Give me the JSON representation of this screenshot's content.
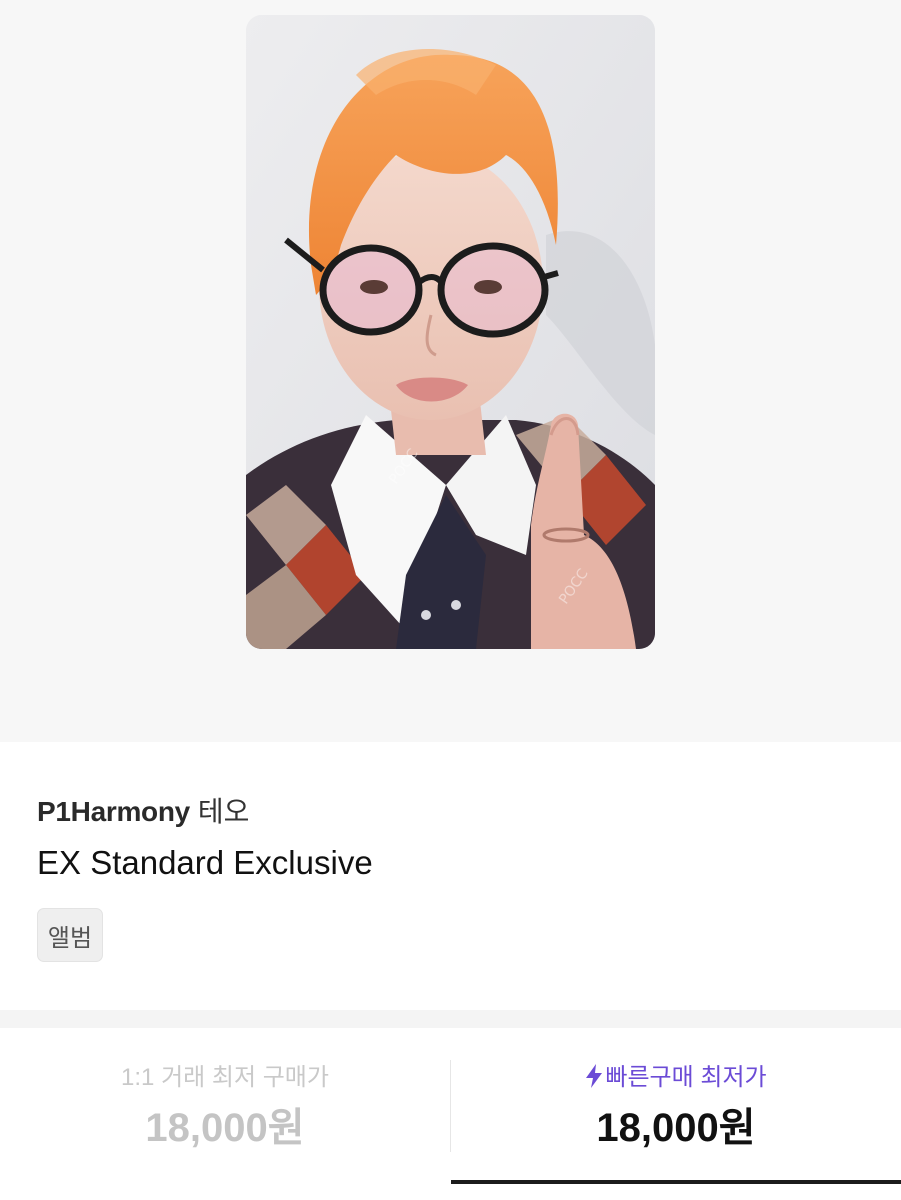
{
  "product": {
    "artist": "P1Harmony",
    "member": "테오",
    "title": "EX Standard Exclusive",
    "tag": "앨범"
  },
  "price_tabs": [
    {
      "label": "1:1 거래 최저 구매가",
      "price": "18,000원",
      "active": false
    },
    {
      "label": "빠른구매 최저가",
      "price": "18,000원",
      "active": true,
      "icon": "lightning-bolt-icon"
    }
  ],
  "colors": {
    "accent": "#6b4bd6",
    "inactive_text": "#c4c4c4",
    "hair": "#f08a3a",
    "background": "#f7f7f7"
  }
}
